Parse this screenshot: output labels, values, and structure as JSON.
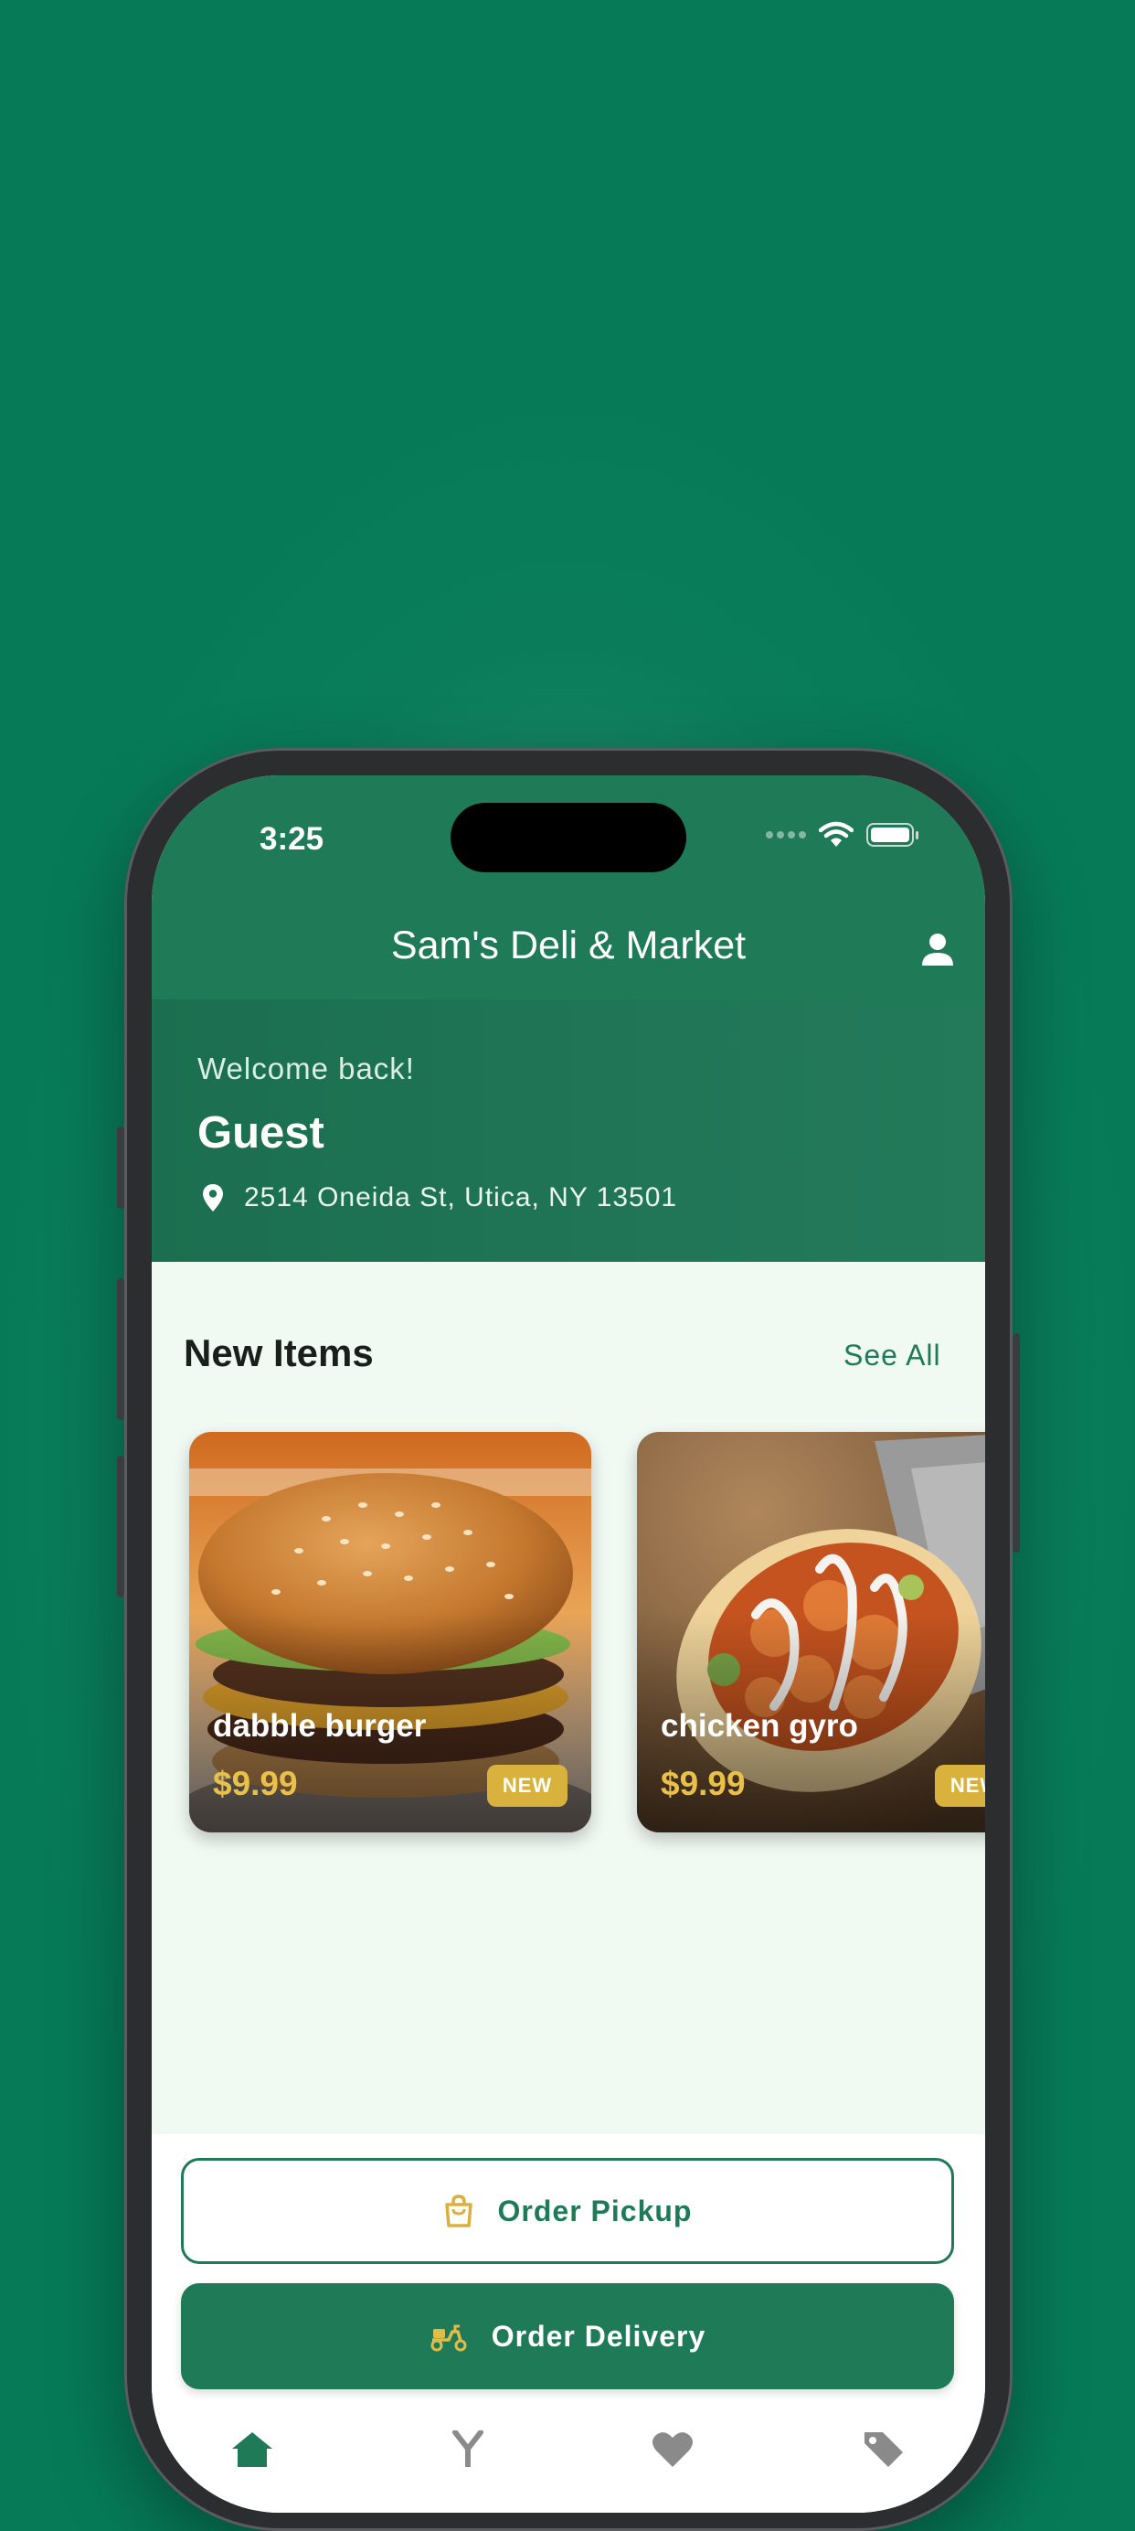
{
  "status_bar": {
    "time": "3:25"
  },
  "header": {
    "title": "Sam's Deli & Market",
    "profile_icon": "person-icon"
  },
  "welcome": {
    "greeting": "Welcome back!",
    "name": "Guest",
    "address": "2514 Oneida St, Utica, NY 13501",
    "location_icon": "map-pin-icon"
  },
  "new_items": {
    "title": "New Items",
    "see_all_label": "See All",
    "items": [
      {
        "name": "dabble burger",
        "price": "$9.99",
        "badge": "NEW"
      },
      {
        "name": "chicken gyro",
        "price": "$9.99",
        "badge": "NEW"
      }
    ]
  },
  "actions": {
    "pickup_label": "Order Pickup",
    "pickup_icon": "shopping-bag-icon",
    "delivery_label": "Order Delivery",
    "delivery_icon": "scooter-icon"
  },
  "bottom_nav": {
    "items": [
      {
        "icon": "home-icon"
      },
      {
        "icon": "utensils-icon"
      },
      {
        "icon": "heart-icon"
      },
      {
        "icon": "tag-icon"
      }
    ]
  },
  "colors": {
    "brand_green": "#1f7a58",
    "background_green": "#0a7c5a",
    "accent_gold": "#d9b23d",
    "screen_background": "#f1f9f3"
  }
}
